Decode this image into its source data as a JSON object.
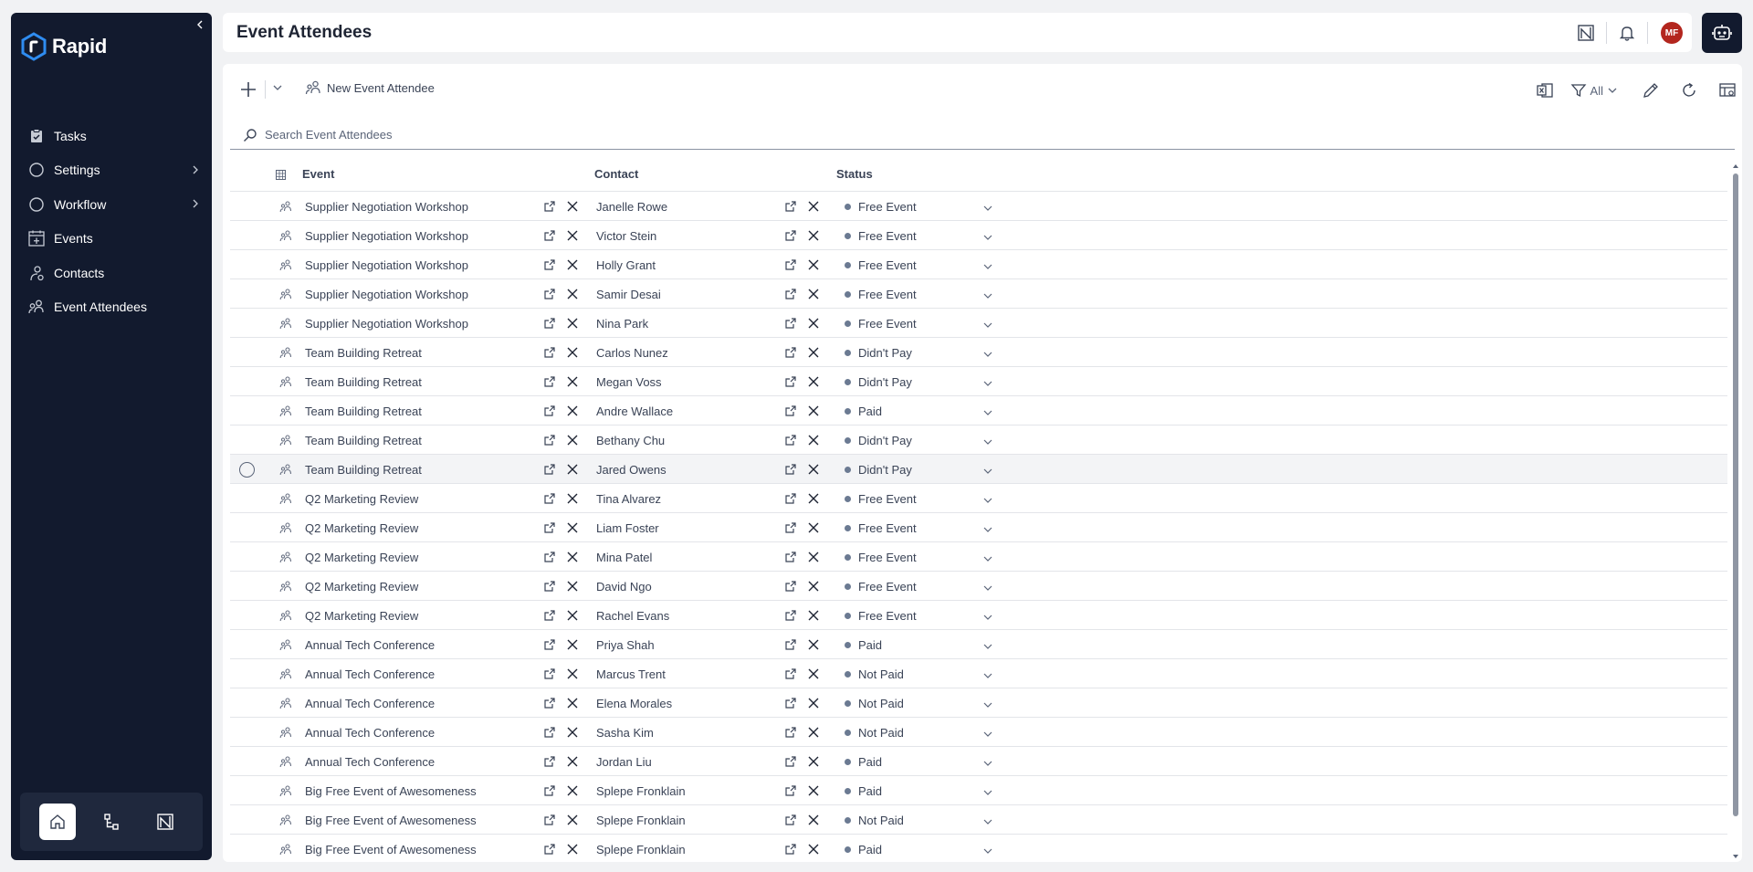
{
  "app": {
    "name": "Rapid"
  },
  "sidebar": {
    "items": [
      {
        "label": "Tasks",
        "icon": "clipboard-icon"
      },
      {
        "label": "Settings",
        "icon": "circle-icon",
        "has_children": true
      },
      {
        "label": "Workflow",
        "icon": "circle-icon",
        "has_children": true
      },
      {
        "label": "Events",
        "icon": "calendar-plus-icon"
      },
      {
        "label": "Contacts",
        "icon": "contact-icon"
      },
      {
        "label": "Event Attendees",
        "icon": "attendees-icon"
      }
    ],
    "bottom": [
      "home-icon",
      "workflow-icon",
      "analytics-icon"
    ]
  },
  "header": {
    "title": "Event Attendees",
    "avatar_initials": "MF"
  },
  "toolbar": {
    "new_label": "New Event Attendee",
    "filter_label": "All"
  },
  "search": {
    "placeholder": "Search Event Attendees"
  },
  "table": {
    "columns": [
      "Event",
      "Contact",
      "Status"
    ],
    "rows": [
      {
        "event": "Supplier Negotiation Workshop",
        "contact": "Janelle Rowe",
        "status": "Free Event"
      },
      {
        "event": "Supplier Negotiation Workshop",
        "contact": "Victor Stein",
        "status": "Free Event"
      },
      {
        "event": "Supplier Negotiation Workshop",
        "contact": "Holly Grant",
        "status": "Free Event"
      },
      {
        "event": "Supplier Negotiation Workshop",
        "contact": "Samir Desai",
        "status": "Free Event"
      },
      {
        "event": "Supplier Negotiation Workshop",
        "contact": "Nina Park",
        "status": "Free Event"
      },
      {
        "event": "Team Building Retreat",
        "contact": "Carlos Nunez",
        "status": "Didn't Pay"
      },
      {
        "event": "Team Building Retreat",
        "contact": "Megan Voss",
        "status": "Didn't Pay"
      },
      {
        "event": "Team Building Retreat",
        "contact": "Andre Wallace",
        "status": "Paid"
      },
      {
        "event": "Team Building Retreat",
        "contact": "Bethany Chu",
        "status": "Didn't Pay"
      },
      {
        "event": "Team Building Retreat",
        "contact": "Jared Owens",
        "status": "Didn't Pay"
      },
      {
        "event": "Q2 Marketing Review",
        "contact": "Tina Alvarez",
        "status": "Free Event"
      },
      {
        "event": "Q2 Marketing Review",
        "contact": "Liam Foster",
        "status": "Free Event"
      },
      {
        "event": "Q2 Marketing Review",
        "contact": "Mina Patel",
        "status": "Free Event"
      },
      {
        "event": "Q2 Marketing Review",
        "contact": "David Ngo",
        "status": "Free Event"
      },
      {
        "event": "Q2 Marketing Review",
        "contact": "Rachel Evans",
        "status": "Free Event"
      },
      {
        "event": "Annual Tech Conference",
        "contact": "Priya Shah",
        "status": "Paid"
      },
      {
        "event": "Annual Tech Conference",
        "contact": "Marcus Trent",
        "status": "Not Paid"
      },
      {
        "event": "Annual Tech Conference",
        "contact": "Elena Morales",
        "status": "Not Paid"
      },
      {
        "event": "Annual Tech Conference",
        "contact": "Sasha Kim",
        "status": "Not Paid"
      },
      {
        "event": "Annual Tech Conference",
        "contact": "Jordan Liu",
        "status": "Paid"
      },
      {
        "event": "Big Free Event of Awesomeness",
        "contact": "Splepe Fronklain",
        "status": "Paid"
      },
      {
        "event": "Big Free Event of Awesomeness",
        "contact": "Splepe Fronklain",
        "status": "Not Paid"
      },
      {
        "event": "Big Free Event of Awesomeness",
        "contact": "Splepe Fronklain",
        "status": "Paid"
      }
    ]
  },
  "colors": {
    "sidebar_bg": "#121a2e",
    "avatar_bg": "#b3261e",
    "status_dot": "#6b7a92"
  }
}
